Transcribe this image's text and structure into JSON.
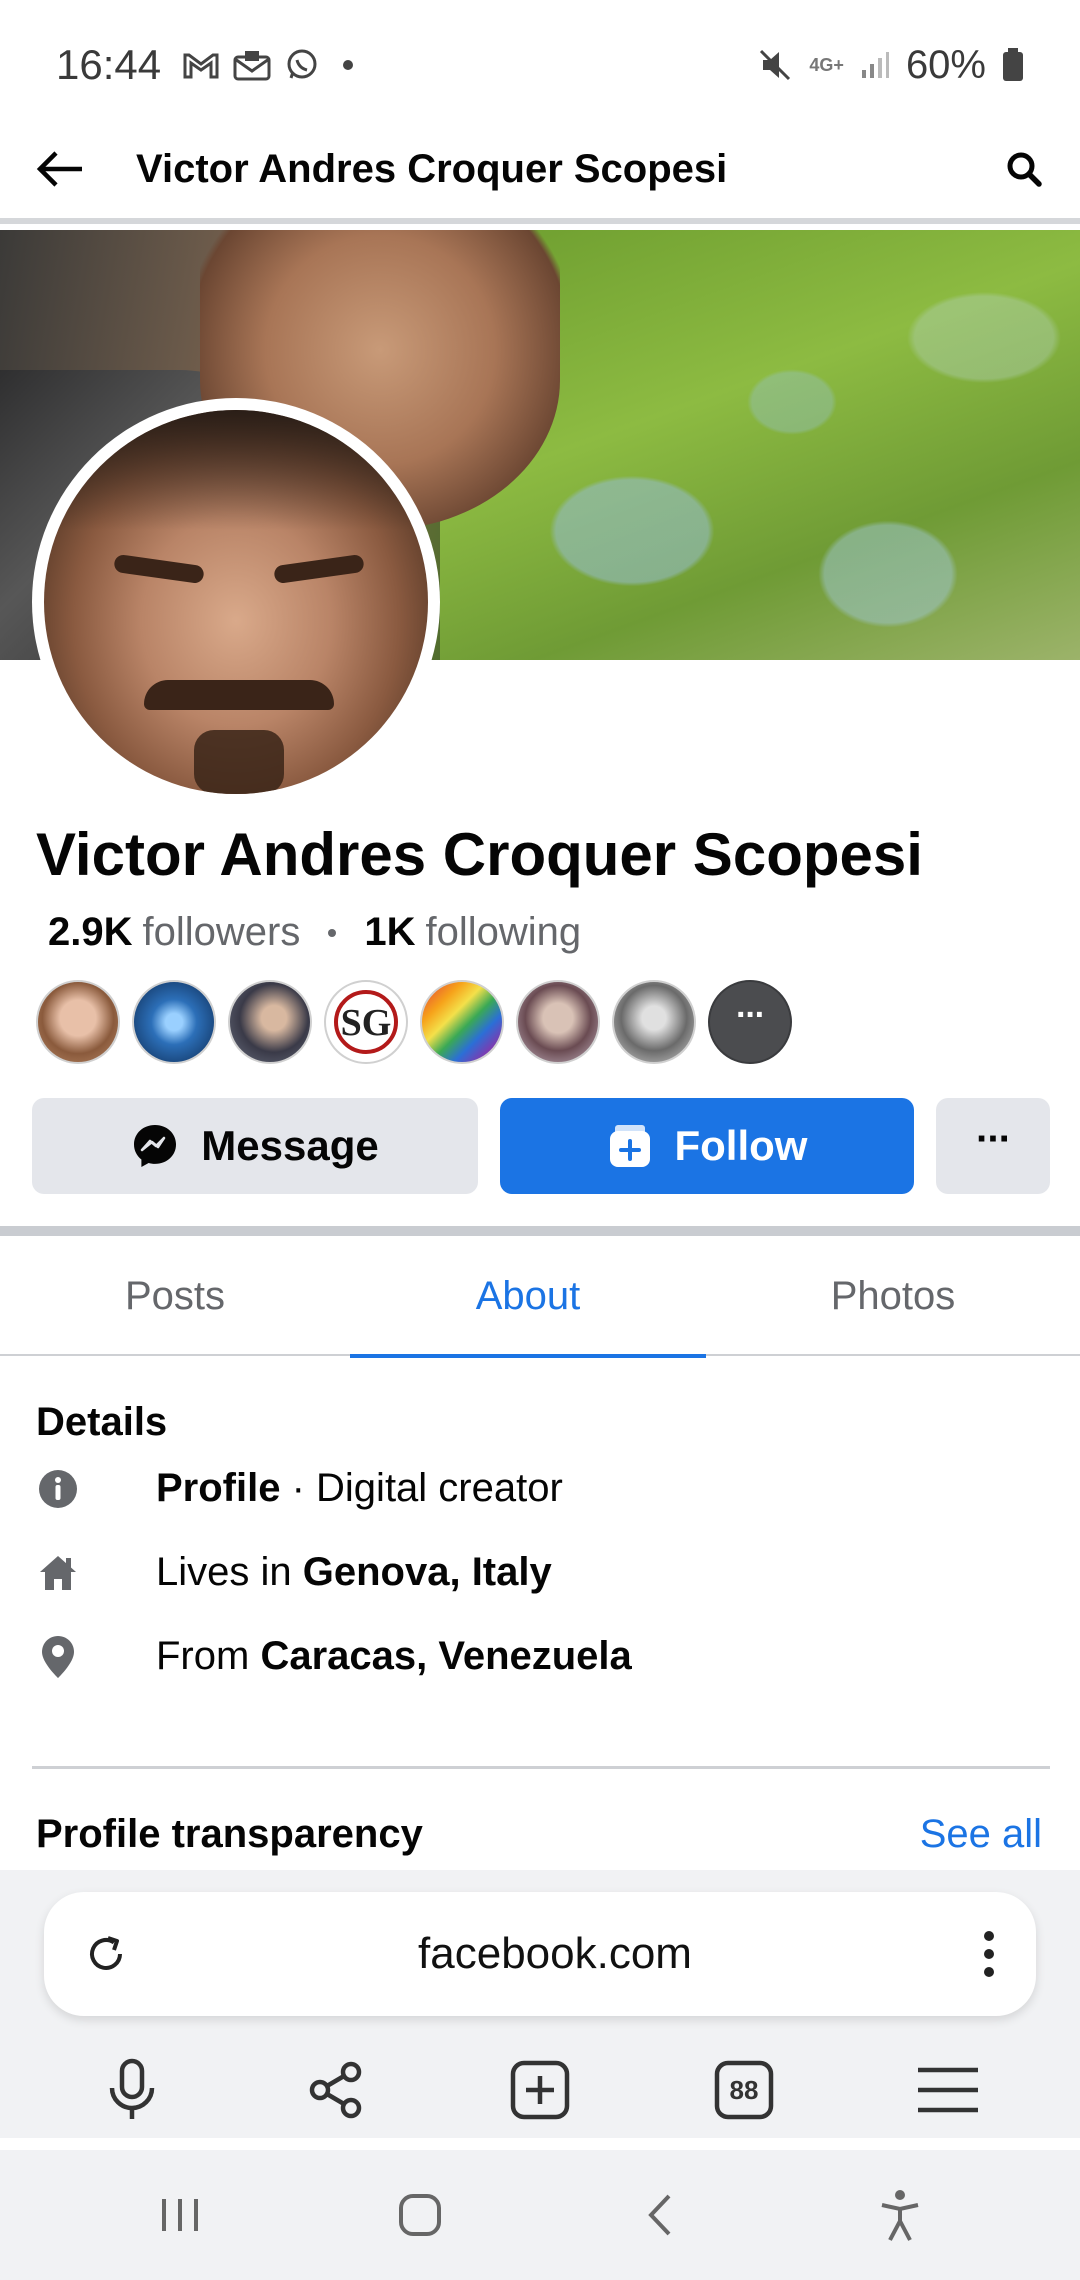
{
  "status_bar": {
    "time": "16:44",
    "network": "4G+",
    "battery": "60%"
  },
  "header": {
    "title": "Victor Andres Croquer Scopesi",
    "back_icon": "arrow-left-icon",
    "search_icon": "search-icon"
  },
  "profile": {
    "name": "Victor Andres Croquer Scopesi",
    "followers_count": "2.9K",
    "followers_label": "followers",
    "following_count": "1K",
    "following_label": "following",
    "more_friends": "···"
  },
  "actions": {
    "message_label": "Message",
    "follow_label": "Follow",
    "more_label": "···"
  },
  "tabs": [
    {
      "label": "Posts",
      "active": false
    },
    {
      "label": "About",
      "active": true
    },
    {
      "label": "Photos",
      "active": false
    }
  ],
  "details": {
    "title": "Details",
    "profile_bold": "Profile",
    "profile_rest": " · Digital creator",
    "lives_prefix": "Lives in ",
    "lives_place": "Genova, Italy",
    "from_prefix": "From ",
    "from_place": "Caracas, Venezuela"
  },
  "transparency": {
    "title": "Profile transparency",
    "see_all": "See all"
  },
  "browser": {
    "url": "facebook.com",
    "tabs_count": "88"
  },
  "colors": {
    "accent": "#1b74e4",
    "button_gray": "#e4e6eb",
    "secondary_text": "#65676b"
  }
}
